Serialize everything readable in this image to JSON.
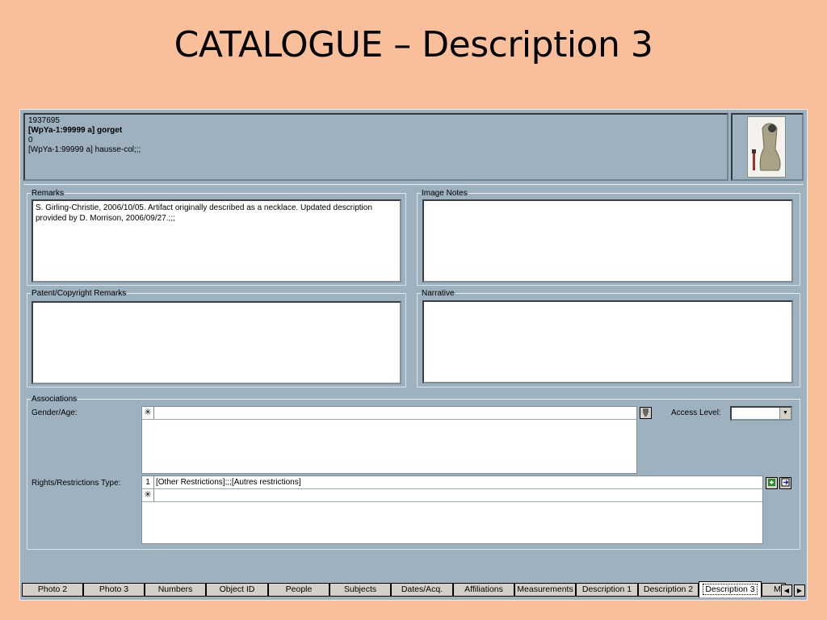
{
  "slide": {
    "title": "CATALOGUE – Description 3"
  },
  "header": {
    "line1": "1937695",
    "line2": "[WpYa-1:99999 a] gorget",
    "line3": "0",
    "line4": "[WpYa-1:99999 a] hausse-col;;;"
  },
  "remarks": {
    "label": "Remarks",
    "value": "S. Girling-Christie, 2006/10/05. Artifact originally described as a necklace. Updated description provided by D. Morrison, 2006/09/27.;;;"
  },
  "image_notes": {
    "label": "Image Notes",
    "value": ""
  },
  "patent": {
    "label": "Patent/Copyright Remarks",
    "value": ""
  },
  "narrative": {
    "label": "Narrative",
    "value": ""
  },
  "associations": {
    "label": "Associations",
    "gender_age_label": "Gender/Age:",
    "new_row_marker": "✳",
    "access_level_label": "Access Level:",
    "access_level_value": "",
    "rights_label": "Rights/Restrictions Type:",
    "rights_rows": [
      {
        "num": "1",
        "value": "[Other Restrictions];;;[Autres restrictions]"
      }
    ]
  },
  "tabs": [
    "Photo 2",
    "Photo 3",
    "Numbers",
    "Object ID",
    "People",
    "Subjects",
    "Dates/Acq.",
    "Affiliations",
    "Measurements",
    "Description 1",
    "Description 2",
    "Description 3",
    "M"
  ],
  "active_tab": "Description 3",
  "icons": {
    "list": "list-icon",
    "add": "add-row-icon",
    "goto": "goto-icon",
    "prev": "scroll-left-icon",
    "next": "scroll-right-icon",
    "dropdown": "chevron-down-icon"
  }
}
